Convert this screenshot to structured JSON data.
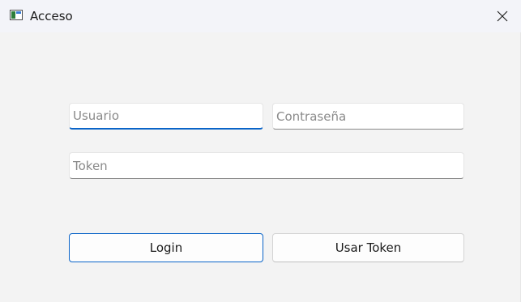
{
  "window": {
    "title": "Acceso",
    "icon": "app-window-icon",
    "close_icon": "close-icon"
  },
  "form": {
    "usuario_placeholder": "Usuario",
    "usuario_value": "",
    "password_placeholder": "Contraseña",
    "password_value": "",
    "token_placeholder": "Token",
    "token_value": ""
  },
  "buttons": {
    "login_label": "Login",
    "use_token_label": "Usar Token"
  },
  "colors": {
    "focus_accent": "#0a64c8",
    "window_bg": "#f3f3f3"
  }
}
